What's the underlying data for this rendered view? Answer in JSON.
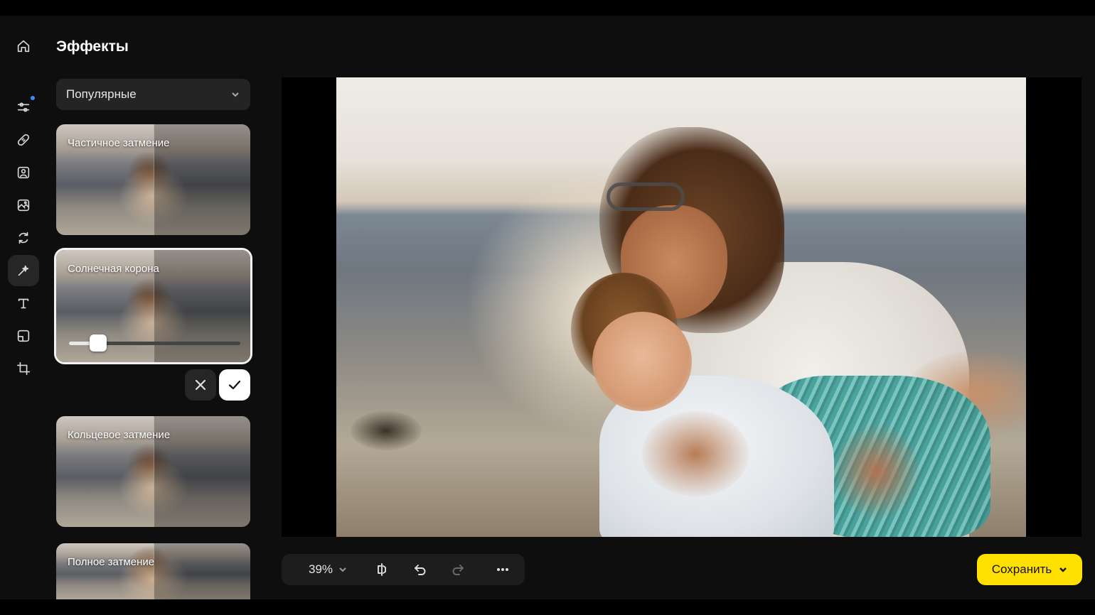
{
  "panel": {
    "title": "Эффекты",
    "category": {
      "selected": "Популярные",
      "icon": "chevron-down-icon"
    }
  },
  "rail": {
    "items": [
      {
        "name": "home",
        "icon": "home-icon"
      },
      {
        "name": "adjustments",
        "icon": "sliders-icon",
        "badge": true
      },
      {
        "name": "retouch",
        "icon": "bandage-icon"
      },
      {
        "name": "portrait",
        "icon": "portrait-icon"
      },
      {
        "name": "image-edit",
        "icon": "image-edit-icon"
      },
      {
        "name": "replace",
        "icon": "refresh-icon"
      },
      {
        "name": "effects",
        "icon": "magic-wand-icon",
        "active": true
      },
      {
        "name": "text",
        "icon": "text-icon"
      },
      {
        "name": "frame",
        "icon": "frame-icon"
      },
      {
        "name": "crop",
        "icon": "crop-icon"
      }
    ]
  },
  "effects": [
    {
      "name": "Частичное затмение"
    },
    {
      "name": "Солнечная корона",
      "selected": true,
      "intensity": 0.12
    },
    {
      "name": "Кольцевое затмение"
    },
    {
      "name": "Полное затмение"
    }
  ],
  "toolbar": {
    "zoom": "39%",
    "buttons": [
      "compare-icon",
      "undo-icon",
      "redo-icon",
      "more-icon"
    ]
  },
  "save": {
    "label": "Сохранить"
  },
  "colors": {
    "accent": "#ffe000",
    "badge": "#3d8cf0",
    "background": "#0e0e0e"
  }
}
